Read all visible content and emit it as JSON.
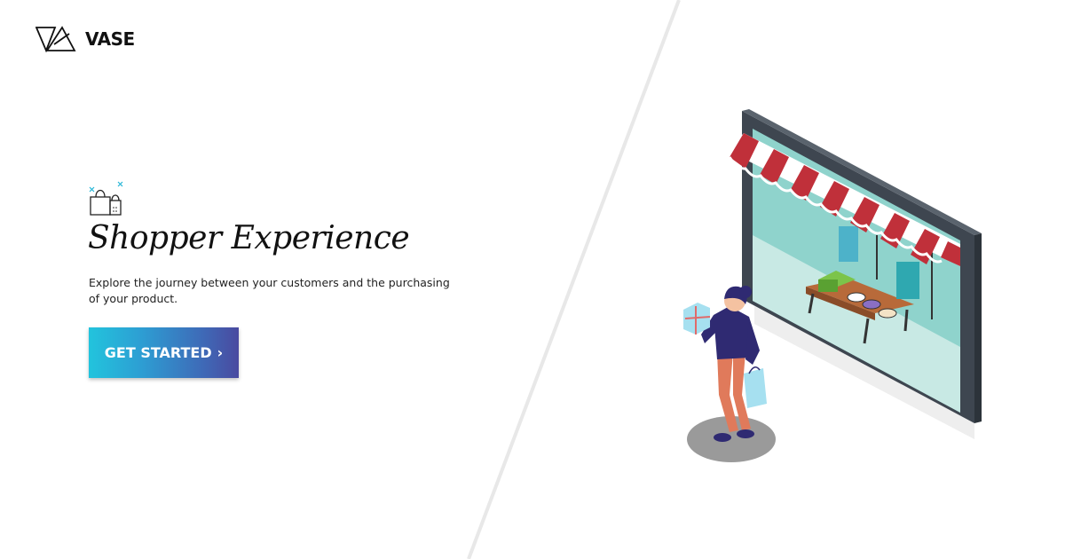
{
  "brand": {
    "name": "VASE"
  },
  "hero": {
    "title": "Shopper Experience",
    "description": "Explore the journey between your customers and the purchasing of your product.",
    "cta_label": "GET STARTED",
    "cta_chevron": "›"
  },
  "icons": {
    "logo": "vase-triangle-logo-icon",
    "hero": "shopping-bag-icon"
  },
  "colors": {
    "cta_gradient_start": "#22c4dd",
    "cta_gradient_end": "#4a4aa0",
    "awning_red": "#c0303a",
    "frame_dark": "#3e4650"
  }
}
